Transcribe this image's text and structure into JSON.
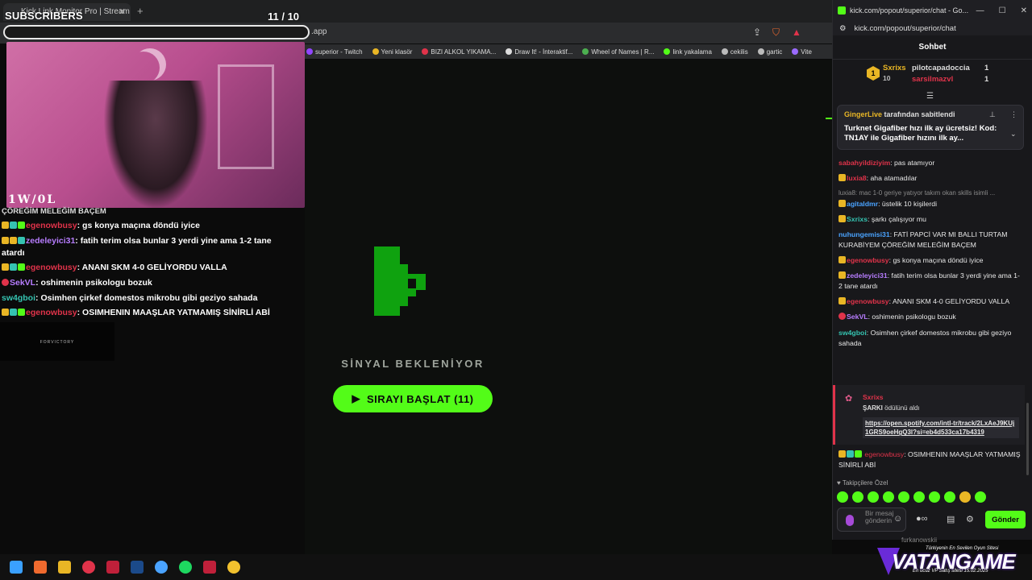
{
  "overlay": {
    "subs_label": "SUBSCRIBERS",
    "subs_count": "11 / 10",
    "cam_logo": "1W/0L",
    "forvictory": "FORVICTORY"
  },
  "browser": {
    "tab_title": "Kick Link Monitor Pro | Stream D...",
    "url_tail": ".app",
    "bookmarks": [
      {
        "label": "superior - Twitch",
        "color": "#9146ff"
      },
      {
        "label": "Yeni klasör",
        "color": "#e9b625"
      },
      {
        "label": "BIZI ALKOL YIKAMA...",
        "color": "#e0334a"
      },
      {
        "label": "Draw It! - İnteraktif...",
        "color": "#ddd"
      },
      {
        "label": "Wheel of Names | R...",
        "color": "#4caf50"
      },
      {
        "label": "link yakalama",
        "color": "#53fc18"
      },
      {
        "label": "cekilis",
        "color": "#bbb"
      },
      {
        "label": "gartic",
        "color": "#bbb"
      },
      {
        "label": "Vite",
        "color": "#9b6bff"
      }
    ]
  },
  "overlay_chat": [
    {
      "text": "ÇÖREĞİM MELEĞİM BAÇEM",
      "cut": true
    },
    {
      "user": "egenowbusy",
      "color": "#e0334a",
      "badges": [
        "gold",
        "teal",
        "green"
      ],
      "text": "gs konya maçına döndü iyice"
    },
    {
      "user": "zedeleyici31",
      "color": "#b77dff",
      "badges": [
        "gold",
        "gold",
        "teal"
      ],
      "text": "fatih terim olsa bunlar 3 yerdi yine ama 1-2 tane atardı"
    },
    {
      "user": "egenowbusy",
      "color": "#e0334a",
      "badges": [
        "gold",
        "teal",
        "green"
      ],
      "text": "ANANI SKM 4-0 GELİYORDU VALLA"
    },
    {
      "user": "SekVL",
      "color": "#b77dff",
      "badges": [
        "red"
      ],
      "text": "oshimenin psikologu bozuk"
    },
    {
      "user": "sw4gboi",
      "color": "#35c3b1",
      "badges": [],
      "text": "Osimhen çirkef domestos mikrobu gibi geziyo sahada"
    },
    {
      "user": "egenowbusy",
      "color": "#e0334a",
      "badges": [
        "gold",
        "teal",
        "green"
      ],
      "text": "OSIMHENIN MAAŞLAR YATMAMIŞ SİNİRLİ ABİ"
    }
  ],
  "main": {
    "signal_text": "SİNYAL BEKLENİYOR",
    "start_button": "SIRAYI BAŞLAT (11)",
    "start_icon": "▶"
  },
  "popout": {
    "title": "kick.com/popout/superior/chat - Go...",
    "url": "kick.com/popout/superior/chat",
    "header": "Sohbet",
    "top_gifter": {
      "rank": "1",
      "name": "Sxrixs",
      "count": "10"
    },
    "gifters": [
      {
        "name": "pilotcapadoccia",
        "count": "1"
      },
      {
        "name": "sarsilmazvl",
        "count": "1"
      }
    ],
    "pinned": {
      "by_user": "GingerLive",
      "by_text": "tarafından sabitlendi",
      "message": "Turknet Gigafiber hızı ilk ay ücretsiz! Kod: TN1AY ile Gigafiber hızını ilk ay..."
    },
    "messages": [
      {
        "user": "sabahyildiziyim",
        "color": "#e0334a",
        "text": ": pas atamıyor"
      },
      {
        "user": "luxia8",
        "color": "#e0334a",
        "text": ": aha atamadılar",
        "badges": "gold"
      },
      {
        "reply": "luxia8: mac 1-0 geriye yatıyor takım okan skills isimli ...",
        "user": "agitaldmr",
        "color": "#4aa3ff",
        "text": ": üstelik 10 kişilerdi",
        "badges": "gold"
      },
      {
        "user": "Sxrixs",
        "color": "#35c3b1",
        "text": ": şarkı çalışıyor mu",
        "badges": "gold"
      },
      {
        "user": "nuhungemisi31",
        "color": "#4aa3ff",
        "text": ": FATİ PAPCİ VAR MI BALLI TURTAM KURABİYEM ÇÖREĞİM MELEĞİM BAÇEM"
      },
      {
        "user": "egenowbusy",
        "color": "#e0334a",
        "text": ": gs konya maçına döndü iyice",
        "badges": "gold"
      },
      {
        "user": "zedeleyici31",
        "color": "#b77dff",
        "text": ": fatih terim olsa bunlar 3 yerdi yine ama 1-2 tane atardı",
        "badges": "gold"
      },
      {
        "user": "egenowbusy",
        "color": "#e0334a",
        "text": ": ANANI SKM 4-0 GELİYORDU VALLA",
        "badges": "gold"
      },
      {
        "user": "SekVL",
        "color": "#b77dff",
        "text": ": oshimenin psikologu bozuk",
        "badges": "red"
      },
      {
        "user": "sw4gboi",
        "color": "#35c3b1",
        "text": ": Osimhen çirkef domestos mikrobu gibi geziyo sahada"
      }
    ],
    "redeem": {
      "user": "Sxrixs",
      "reward_name": "ŞARKI",
      "reward_text": "ödülünü aldı",
      "link": "https://open.spotify.com/intl-tr/track/2LxAeJ9KUj1GRS9oeHgQ3l?si=eb4d533ca17b4319"
    },
    "last_message": {
      "user": "egenowbusy",
      "color": "#e0334a",
      "text": ": OSIMHENIN MAAŞLAR YATMAMIŞ SİNİRLİ ABİ"
    },
    "emote_label": "Takipçilere Özel",
    "input_placeholder": "Bir mesaj gönderin",
    "send_label": "Gönder",
    "below_text": "furkanowskii"
  },
  "vatan": {
    "main": "VATANGAME",
    "sub1": "Türkiyenin En Sevilen Oyun Sitesi",
    "sub2": "En ucuz VP Satış sitesi"
  },
  "date_fragment": "15.02.2025"
}
